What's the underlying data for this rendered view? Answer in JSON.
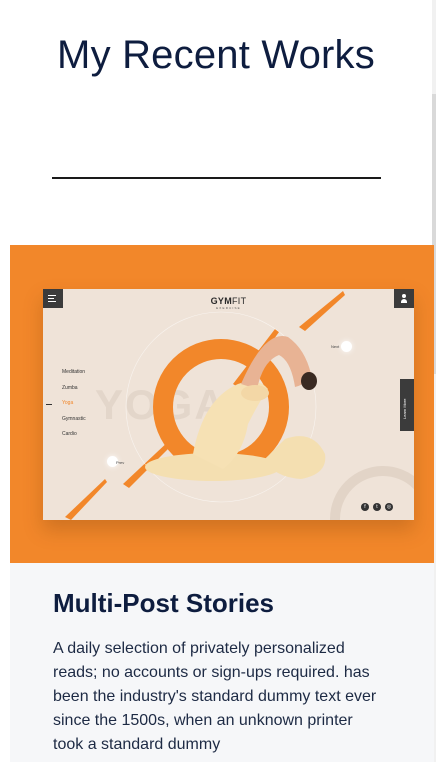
{
  "page": {
    "title": "My Recent Works"
  },
  "project": {
    "title": "Multi-Post Stories",
    "description": "A daily selection of privately personalized reads; no accounts or sign-ups required. has been the industry's standard dummy text ever since the 1500s, when an unknown printer took a standard dummy"
  },
  "mockup": {
    "brand_main": "GYM",
    "brand_accent": "FIT",
    "brand_sub": "EXERCISE",
    "background_word": "YOGA",
    "nav_items": [
      "Meditation",
      "Zumba",
      "Yoga",
      "Gymnastic",
      "Cardio"
    ],
    "active_nav": "Yoga",
    "side_button": "Learn More",
    "next_label": "Next",
    "prev_label": "Prev",
    "social_icons": [
      "facebook-icon",
      "twitter-icon",
      "instagram-icon"
    ]
  },
  "colors": {
    "accent": "#f2872a",
    "title": "#0e1d3f",
    "mock_background": "#efe3d8"
  }
}
